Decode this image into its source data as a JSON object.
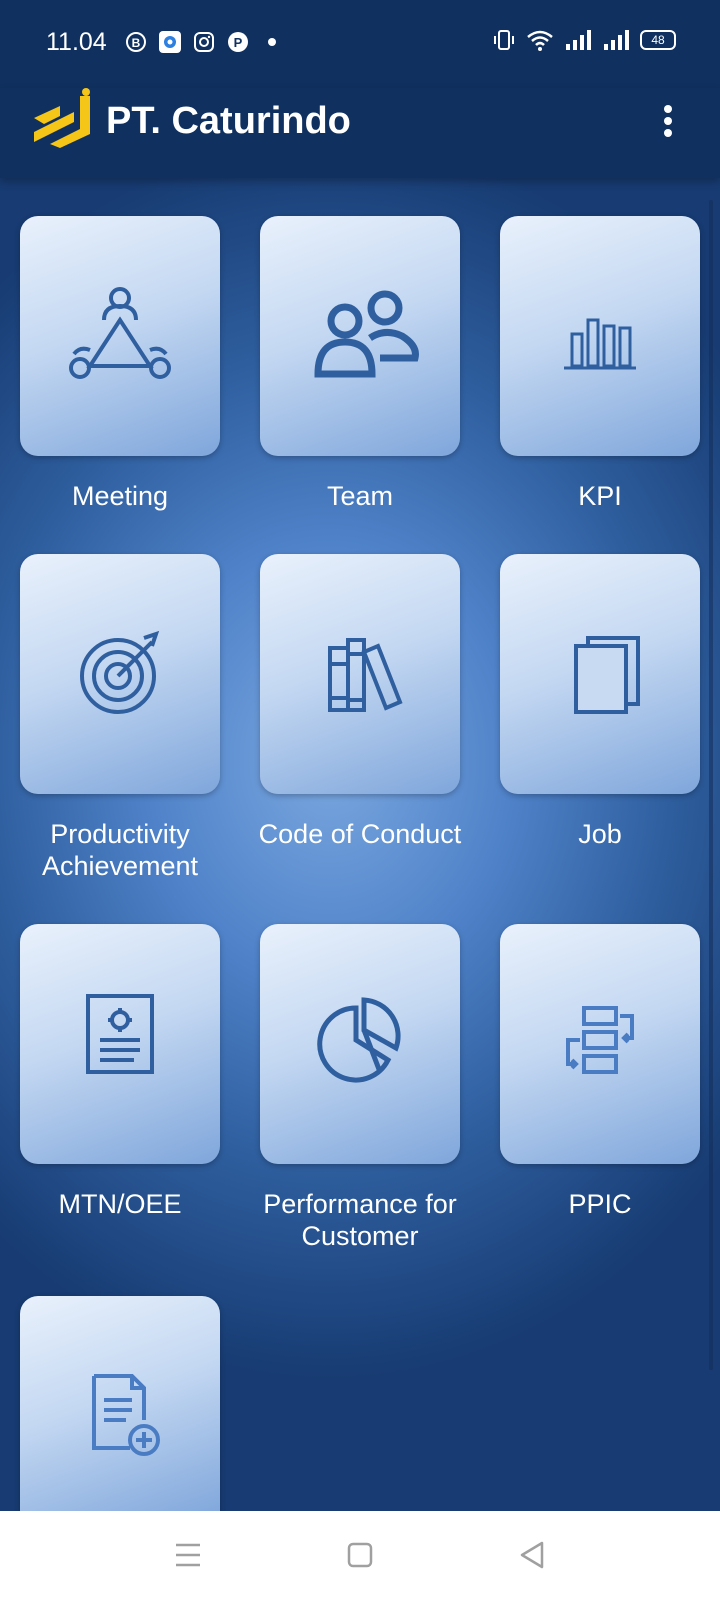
{
  "status_bar": {
    "time": "11.04",
    "notification_icons": [
      "beetalk-icon",
      "signal-app-icon",
      "instagram-icon",
      "pinterest-icon",
      "dot-icon"
    ],
    "system_icons": [
      "vibrate-icon",
      "wifi-icon",
      "signal-icon",
      "signal-icon"
    ],
    "battery": "48"
  },
  "app_bar": {
    "title": "PT. Caturindo",
    "logo": "caturindo-logo",
    "menu_icon": "more-vert-icon"
  },
  "colors": {
    "app_bar": "#10305f",
    "accent_gold": "#f5c518",
    "icon_blue": "#2f5f9f"
  },
  "menu": {
    "items": [
      {
        "label": "Meeting",
        "icon": "meeting-icon"
      },
      {
        "label": "Team",
        "icon": "team-icon"
      },
      {
        "label": "KPI",
        "icon": "bar-chart-icon"
      },
      {
        "label": "Productivity Achievement",
        "icon": "target-icon"
      },
      {
        "label": "Code of Conduct",
        "icon": "books-icon"
      },
      {
        "label": "Job",
        "icon": "copy-pages-icon"
      },
      {
        "label": "MTN/OEE",
        "icon": "document-gear-icon"
      },
      {
        "label": "Performance for Customer",
        "icon": "pie-chart-icon"
      },
      {
        "label": "PPIC",
        "icon": "workflow-icon"
      },
      {
        "label": "",
        "icon": "add-document-icon"
      }
    ]
  },
  "nav_bar": {
    "buttons": [
      "menu-icon",
      "home-square-icon",
      "back-triangle-icon"
    ]
  }
}
